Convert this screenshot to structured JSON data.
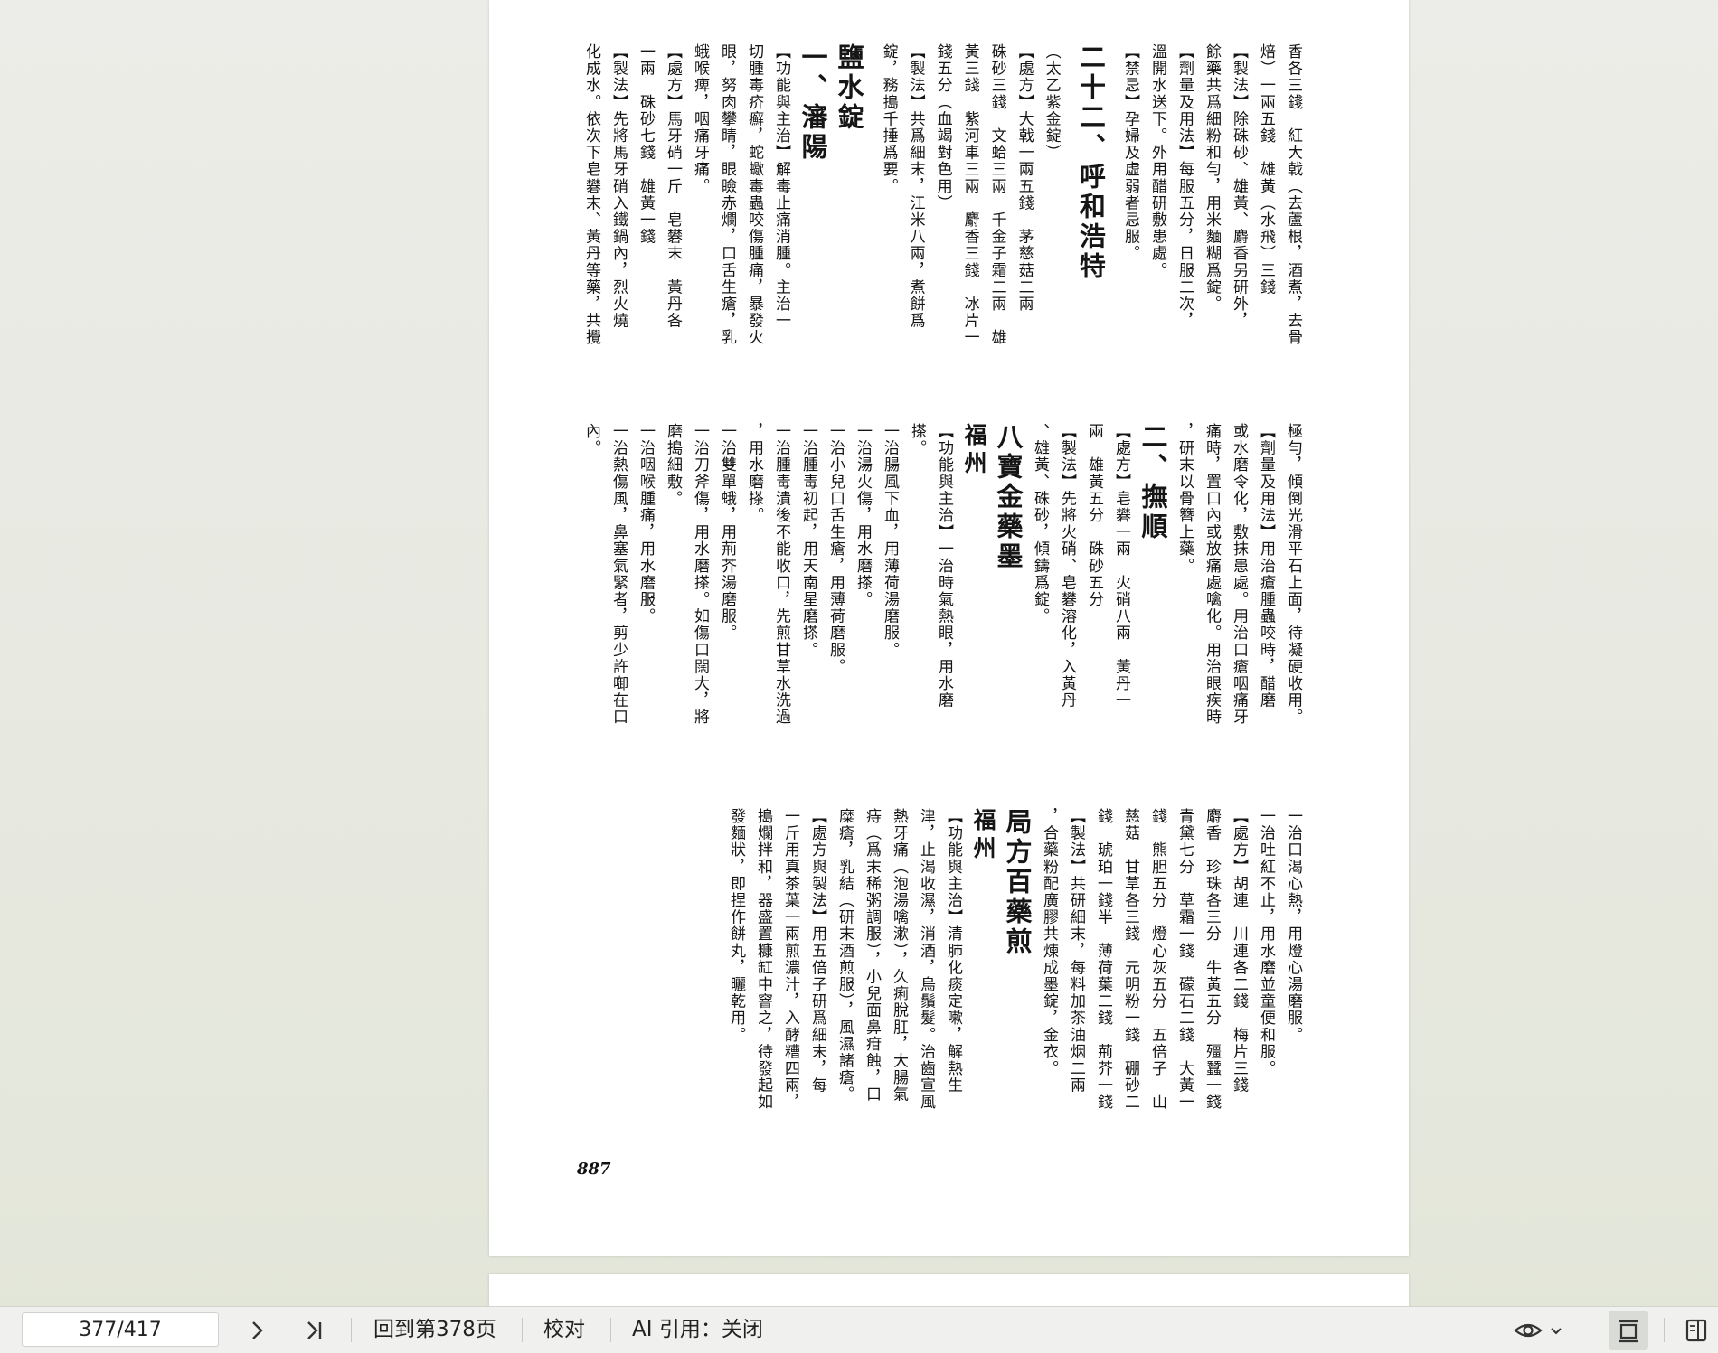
{
  "document": {
    "page_number": "887",
    "band1_columns": [
      "香各三錢　紅大戟（去蘆根，酒煮，去骨",
      "焙）一兩五錢　雄黃（水飛）三錢",
      "【製法】除硃砂、雄黃、麝香另研外，",
      "餘藥共爲細粉和勻，用米麵糊爲錠。",
      "【劑量及用法】每服五分，日服二次，",
      "溫開水送下。外用醋研敷患處。",
      "【禁忌】孕婦及虛弱者忌服。",
      "",
      "二十二、呼和浩特",
      "",
      "（太乙紫金錠）",
      "【處方】大戟一兩五錢　茅慈菇二兩",
      "硃砂三錢　文蛤三兩　千金子霜二兩　雄",
      "黃三錢　紫河車三兩　麝香三錢　冰片一",
      "錢五分（血竭對色用）",
      "【製法】共爲細末，江米八兩，煮餅爲",
      "錠，務搗千捶爲要。",
      "",
      "鹽水錠",
      "一、瀋陽",
      "【功能與主治】解毒止痛消腫。主治一",
      "切腫毒疥癬，蛇蠍毒蟲咬傷腫痛，暴發火",
      "眼，努肉攀睛，眼瞼赤爛，口舌生瘡，乳",
      "蛾喉痺，咽痛牙痛。",
      "【處方】馬牙硝一斤　皂礬末　黃丹各",
      "一兩　硃砂七錢　雄黃一錢",
      "【製法】先將馬牙硝入鐵鍋內，烈火燒",
      "化成水。依次下皂礬末、黃丹等藥，共攪"
    ],
    "band2_columns": [
      "極勻，傾倒光滑平石上面，待凝硬收用。",
      "【劑量及用法】用治瘡腫蟲咬時，醋磨",
      "或水磨令化，敷抹患處。用治口瘡咽痛牙",
      "痛時，置口內或放痛處噙化。用治眼疾時",
      "，研末以骨簪上藥。",
      "",
      "二、撫順",
      "【處方】皂礬一兩　火硝八兩　黃丹一",
      "兩　雄黃五分　硃砂五分",
      "【製法】先將火硝、皂礬溶化，入黃丹",
      "、雄黃、硃砂，傾鑄爲錠。",
      "",
      "八寶金藥墨",
      "福州",
      "【功能與主治】一治時氣熱眼，用水磨",
      "搽。",
      "一治腸風下血，用薄荷湯磨服。",
      "一治湯火傷，用水磨搽。",
      "一治小兒口舌生瘡，用薄荷磨服。",
      "一治腫毒初起，用天南星磨搽。",
      "一治腫毒潰後不能收口，先煎甘草水洗過",
      "，用水磨搽。",
      "一治雙單蛾，用荊芥湯磨服。",
      "一治刀斧傷，用水磨搽。如傷口闊大，將",
      "磨搗細敷。",
      "一治咽喉腫痛，用水磨服。",
      "一治熱傷風，鼻塞氣緊者，剪少許啣在口",
      "內。"
    ],
    "band3_columns": [
      "一治口渴心熱，用燈心湯磨服。",
      "一治吐紅不止，用水磨並童便和服。",
      "【處方】胡連　川連各二錢　梅片三錢",
      "麝香　珍珠各三分　牛黃五分　殭蠶一錢",
      "青黛七分　草霜一錢　礞石二錢　大黃一",
      "錢　熊胆五分　燈心灰五分　五倍子　山",
      "慈菇　甘草各三錢　元明粉一錢　硼砂二",
      "錢　琥珀一錢半　薄荷葉二錢　荊芥一錢",
      "【製法】共研細末，每料加茶油烟二兩",
      "，合藥粉配廣膠共煉成墨錠，金衣。",
      "",
      "局方百藥煎",
      "福州",
      "【功能與主治】清肺化痰定嗽，解熱生",
      "津，止渴收濕，消酒，烏鬚髮。治齒宣風",
      "熱牙痛（泡湯噙漱），久痢脫肛，大腸氣",
      "痔（爲末稀粥調服），小兒面鼻疳蝕，口",
      "糜瘡，乳結（研末酒煎服），風濕諸瘡。",
      "【處方與製法】用五倍子研爲細末，每",
      "一斤用真茶葉一兩煎濃汁，入酵糟四兩，",
      "搗爛拌和，器盛置糠缸中窨之，待發起如",
      "發麵狀，即捏作餅丸，曬乾用。"
    ]
  },
  "toolbar": {
    "page_indicator": "377/417",
    "next_icon": "chevron-right-icon",
    "last_icon": "skip-to-last-icon",
    "back_to_page": "回到第378页",
    "proofread": "校对",
    "ai_citation": "AI 引用：关闭",
    "view_icon": "eye-icon",
    "view_dropdown_icon": "chevron-down-icon",
    "single_page_icon": "single-page-layout-icon",
    "panel_icon": "side-panel-icon"
  }
}
